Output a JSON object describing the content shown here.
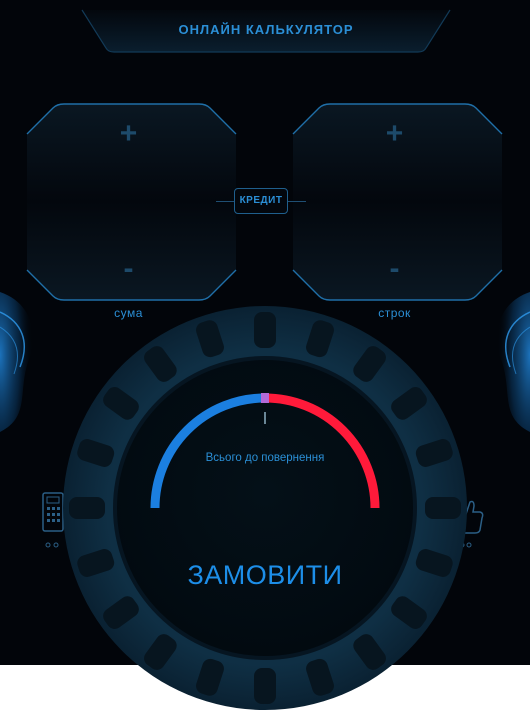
{
  "header": {
    "title": "ОНЛАЙН КАЛЬКУЛЯТОР"
  },
  "controls": {
    "amount": {
      "plus": "+",
      "minus": "-",
      "label": "сума"
    },
    "term": {
      "plus": "+",
      "minus": "-",
      "label": "строк"
    },
    "credit_label": "КРЕДИТ"
  },
  "gauge": {
    "caption": "Всього до повернення",
    "level": 0.5,
    "colors": {
      "left": "#1b7fe0",
      "right": "#ff1a3a",
      "mid": "#b36ad8"
    }
  },
  "order_button": {
    "label": "ЗАМОВИТИ"
  },
  "icons": {
    "left": "calculator-icon",
    "right": "thumbs-up-icon"
  },
  "theme": {
    "accent": "#2b8fd6",
    "background": "#02050a",
    "dial": "#0b2638"
  }
}
